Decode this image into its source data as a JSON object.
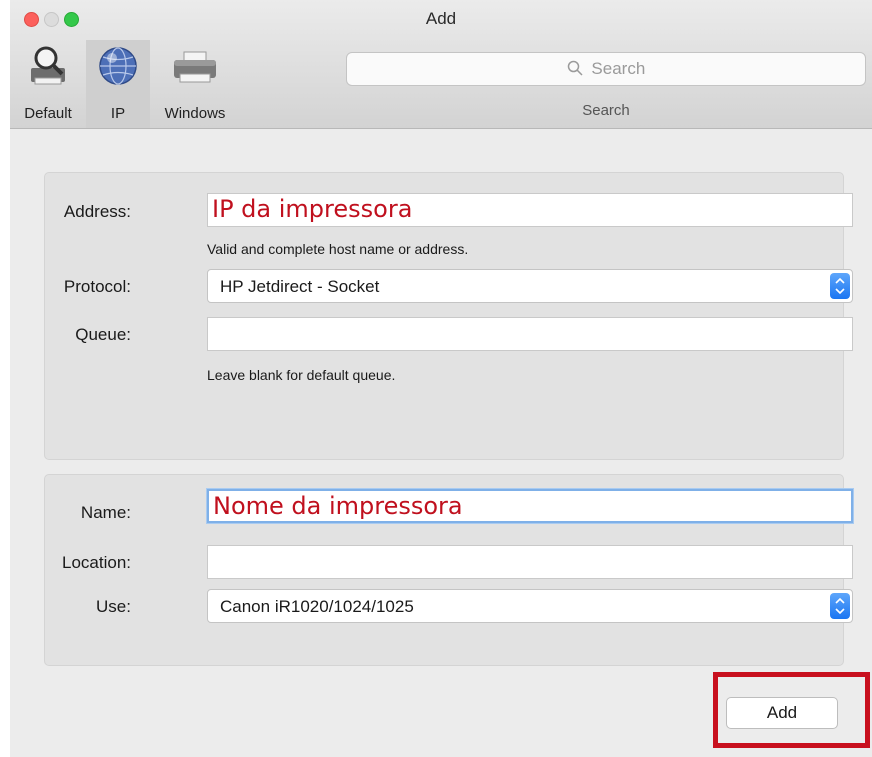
{
  "window": {
    "title": "Add"
  },
  "toolbar": {
    "tabs": [
      {
        "label": "Default",
        "icon": "magnifier-printer-icon"
      },
      {
        "label": "IP",
        "icon": "globe-icon",
        "selected": true
      },
      {
        "label": "Windows",
        "icon": "printer-icon"
      }
    ],
    "search_placeholder": "Search",
    "search_label": "Search"
  },
  "ip_panel": {
    "address_label": "Address:",
    "address_value": "IP da impressora",
    "address_hint": "Valid and complete host name or address.",
    "protocol_label": "Protocol:",
    "protocol_value": "HP Jetdirect - Socket",
    "queue_label": "Queue:",
    "queue_value": "",
    "queue_hint": "Leave blank for default queue."
  },
  "printer_panel": {
    "name_label": "Name:",
    "name_value": "Nome da impressora",
    "location_label": "Location:",
    "location_value": "",
    "use_label": "Use:",
    "use_value": "Canon iR1020/1024/1025"
  },
  "footer": {
    "add_label": "Add"
  },
  "colors": {
    "annotation_red": "#c8101e",
    "stepper_blue": "#1b76f2"
  }
}
